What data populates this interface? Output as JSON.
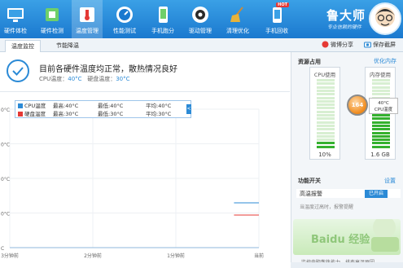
{
  "nav": {
    "items": [
      {
        "label": "硬件体检",
        "icon": "monitor-icon"
      },
      {
        "label": "硬件检测",
        "icon": "chip-icon"
      },
      {
        "label": "温度管理",
        "icon": "thermometer-icon"
      },
      {
        "label": "性能测试",
        "icon": "speedometer-icon"
      },
      {
        "label": "手机跑分",
        "icon": "phone-icon"
      },
      {
        "label": "驱动管理",
        "icon": "gear-icon"
      },
      {
        "label": "清理优化",
        "icon": "broom-icon"
      },
      {
        "label": "手机回收",
        "icon": "phone-recycle-icon"
      }
    ],
    "hot_badge": "HOT"
  },
  "brand": {
    "title": "鲁大师",
    "subtitle": "专业信赖的硬件"
  },
  "tabs": {
    "items": [
      "温度监控",
      "节能降温"
    ]
  },
  "toolbar": {
    "share": "微博分享",
    "screenshot": "保存截屏"
  },
  "status": {
    "message": "目前各硬件温度均正常，散热情况良好",
    "cpu_label": "CPU温度：",
    "cpu_value": "40°C",
    "disk_label": "硬盘温度：",
    "disk_value": "30°C"
  },
  "legend": {
    "rows": [
      {
        "name": "CPU温度",
        "max": "最高:40°C",
        "min": "最低:40°C",
        "avg": "平均:40°C",
        "color": "#2b8ad6"
      },
      {
        "name": "硬盘温度",
        "max": "最高:30°C",
        "min": "最低:30°C",
        "avg": "平均:30°C",
        "color": "#e53935"
      }
    ],
    "toggle": "<"
  },
  "chart_data": {
    "type": "line",
    "title": "",
    "xlabel": "",
    "ylabel": "",
    "x_tick_labels": [
      "3分钟前",
      "2分钟前",
      "1分钟前",
      "当前"
    ],
    "y_tick_labels": [
      "0°C",
      "0°C",
      "0°C",
      "0°C",
      "C"
    ],
    "series": [
      {
        "name": "CPU温度",
        "color": "#2b8ad6",
        "values": [
          40,
          40
        ],
        "x_fraction": [
          0.9,
          1.0
        ]
      },
      {
        "name": "硬盘温度",
        "color": "#e53935",
        "values": [
          30,
          30
        ],
        "x_fraction": [
          0.9,
          1.0
        ]
      }
    ],
    "ylim": [
      0,
      100
    ],
    "grid": true
  },
  "right": {
    "resource_title": "资源占用",
    "optimize_link": "优化内存",
    "cpu_meter": {
      "label": "CPU使用",
      "value": "10%",
      "fraction": 0.1
    },
    "mem_meter": {
      "label": "内存使用",
      "value": "1.6 GB",
      "fraction": 0.62
    },
    "gauge_value": "164",
    "tip_line1": "40°C",
    "tip_line2": "CPU温度",
    "function_title": "功能开关",
    "settings_link": "设置",
    "alert_label": "高温报警",
    "alert_state": "已开启",
    "alert_desc": "当温度过高时，报警提醒",
    "banner_text": "Baidu 经验",
    "banner_foot": "监控电脑散热能力，排查高温原因"
  }
}
